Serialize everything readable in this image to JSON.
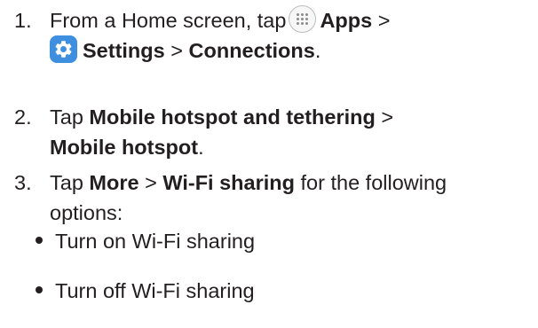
{
  "steps": [
    {
      "number": "1.",
      "line1": {
        "text_before": "From a Home screen, tap",
        "apps_icon": "apps-grid-icon",
        "apps_label": "Apps",
        "sep": " >"
      },
      "line2": {
        "settings_icon": "settings-gear-icon",
        "settings_label": "Settings",
        "sep": " > ",
        "connections_label": "Connections",
        "end": "."
      }
    },
    {
      "number": "2.",
      "line1": {
        "text_before": "Tap ",
        "bold1": "Mobile hotspot and tethering",
        "sep": " >"
      },
      "line2": {
        "bold2": "Mobile hotspot",
        "end": "."
      }
    },
    {
      "number": "3.",
      "line1": {
        "text_before": "Tap ",
        "bold1": "More",
        "sep": " > ",
        "bold2": "Wi-Fi sharing",
        "text_after": " for the following"
      },
      "line2": {
        "text": "options:"
      }
    }
  ],
  "bullets": [
    "Turn on Wi-Fi sharing",
    "Turn off Wi-Fi sharing"
  ],
  "colors": {
    "text": "#231f20",
    "settings_icon_bg": "#3f8fe0"
  }
}
